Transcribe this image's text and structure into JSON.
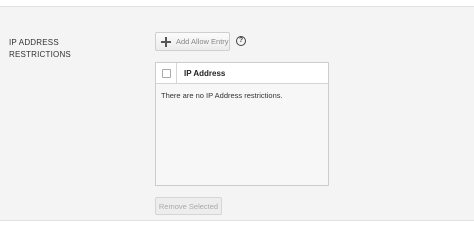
{
  "section": {
    "label_line1": "IP ADDRESS",
    "label_line2": "RESTRICTIONS"
  },
  "toolbar": {
    "add_label": "Add Allow Entry",
    "help_glyph": "?",
    "add_icon": "plus-icon",
    "help_icon": "question-circle-icon"
  },
  "table": {
    "columns": [
      "IP Address"
    ],
    "empty_message": "There are no IP Address restrictions.",
    "select_all_checked": false
  },
  "actions": {
    "remove_label": "Remove Selected",
    "remove_enabled": false
  }
}
